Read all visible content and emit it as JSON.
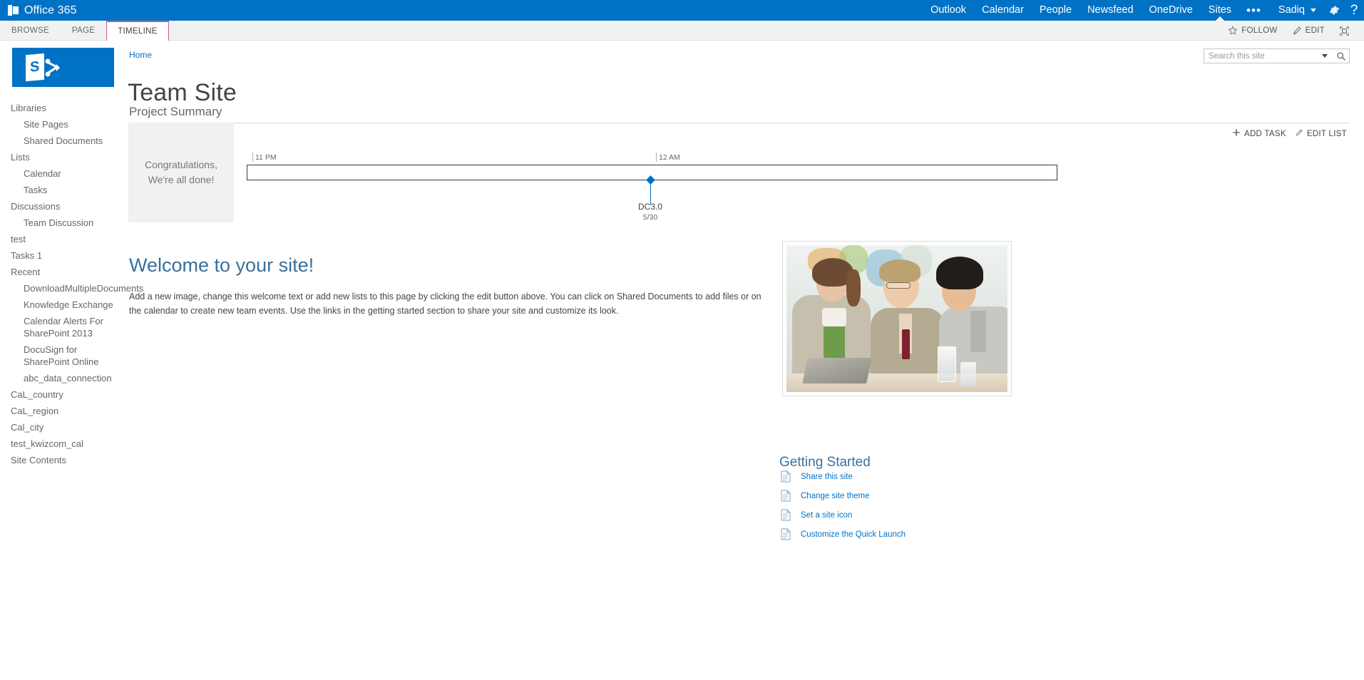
{
  "suite_bar": {
    "brand": "Office 365",
    "brand_icon": "office-tile-icon",
    "nav": [
      {
        "label": "Outlook",
        "active": false
      },
      {
        "label": "Calendar",
        "active": false
      },
      {
        "label": "People",
        "active": false
      },
      {
        "label": "Newsfeed",
        "active": false
      },
      {
        "label": "OneDrive",
        "active": false
      },
      {
        "label": "Sites",
        "active": true
      }
    ],
    "overflow_label": "•••",
    "user_name": "Sadiq",
    "settings_icon": "gear-icon",
    "help_icon": "question-mark-icon",
    "background": "#0072c6"
  },
  "ribbon": {
    "tabs": [
      {
        "label": "BROWSE",
        "selected": false
      },
      {
        "label": "PAGE",
        "selected": false
      },
      {
        "label": "TIMELINE",
        "selected": true
      }
    ],
    "selected_accent": "#c55a9b",
    "actions": [
      {
        "label": "FOLLOW",
        "icon": "star-icon"
      },
      {
        "label": "EDIT",
        "icon": "pencil-icon"
      }
    ],
    "focus_button_icon": "focus-on-content-icon"
  },
  "logo": {
    "icon": "sharepoint-logo-icon",
    "color": "#0072c6"
  },
  "quick_launch": [
    {
      "label": "Libraries",
      "child": false
    },
    {
      "label": "Site Pages",
      "child": true
    },
    {
      "label": "Shared Documents",
      "child": true
    },
    {
      "label": "Lists",
      "child": false
    },
    {
      "label": "Calendar",
      "child": true
    },
    {
      "label": "Tasks",
      "child": true
    },
    {
      "label": "Discussions",
      "child": false
    },
    {
      "label": "Team Discussion",
      "child": true
    },
    {
      "label": "test",
      "child": false
    },
    {
      "label": "Tasks 1",
      "child": false
    },
    {
      "label": "Recent",
      "child": false
    },
    {
      "label": "DownloadMultipleDocuments",
      "child": true
    },
    {
      "label": "Knowledge Exchange",
      "child": true
    },
    {
      "label": "Calendar Alerts For SharePoint 2013",
      "child": true
    },
    {
      "label": "DocuSign for SharePoint Online",
      "child": true
    },
    {
      "label": "abc_data_connection",
      "child": true
    },
    {
      "label": "CaL_country",
      "child": false
    },
    {
      "label": "CaL_region",
      "child": false
    },
    {
      "label": "Cal_city",
      "child": false
    },
    {
      "label": "test_kwizcom_cal",
      "child": false
    },
    {
      "label": "Site Contents",
      "child": false
    }
  ],
  "header": {
    "breadcrumb": "Home",
    "title": "Team Site"
  },
  "search": {
    "placeholder": "Search this site",
    "value": "",
    "caret_icon": "chevron-down-icon",
    "go_icon": "search-icon"
  },
  "project_summary": {
    "title": "Project Summary",
    "toolbar": [
      {
        "label": "ADD TASK",
        "icon": "plus-icon"
      },
      {
        "label": "EDIT LIST",
        "icon": "pencil-icon"
      }
    ],
    "status_message": "Congratulations,\nWe're all done!",
    "timeline": {
      "ticks": [
        {
          "label": "11 PM",
          "position_pct": 0.7
        },
        {
          "label": "12 AM",
          "position_pct": 50.5
        }
      ],
      "milestones": [
        {
          "label": "DC3.0",
          "date": "5/30",
          "position_pct": 49.8,
          "color": "#0072c6"
        }
      ]
    }
  },
  "welcome": {
    "heading": "Welcome to your site!",
    "body": "Add a new image, change this welcome text or add new lists to this page by clicking the edit button above. You can click on Shared Documents to add files or on the calendar to create new team events. Use the links in the getting started section to share your site and customize its look.",
    "photo_alt": "three-colleagues-at-laptop-photo"
  },
  "getting_started": {
    "heading": "Getting Started",
    "items": [
      {
        "label": "Share this site",
        "icon": "document-icon"
      },
      {
        "label": "Change site theme",
        "icon": "document-icon"
      },
      {
        "label": "Set a site icon",
        "icon": "document-icon"
      },
      {
        "label": "Customize the Quick Launch",
        "icon": "document-icon"
      }
    ]
  }
}
